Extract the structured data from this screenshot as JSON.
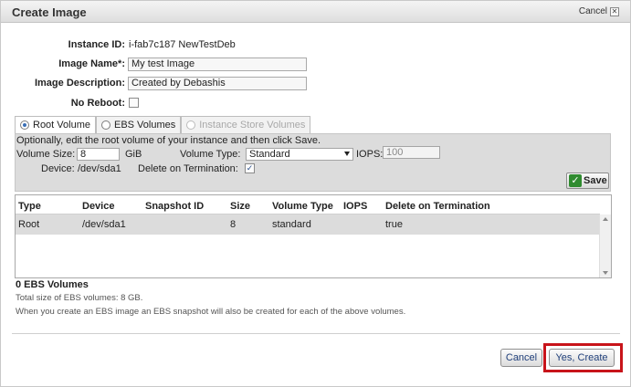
{
  "dialog": {
    "title": "Create Image",
    "cancel_link": "Cancel"
  },
  "form": {
    "instance_id_label": "Instance ID:",
    "instance_id_value": "i-fab7c187 NewTestDeb",
    "image_name_label": "Image Name*:",
    "image_name_value": "My test Image",
    "image_description_label": "Image Description:",
    "image_description_value": "Created by Debashis",
    "no_reboot_label": "No Reboot:"
  },
  "tabs": [
    {
      "label": "Root Volume",
      "selected": true,
      "disabled": false
    },
    {
      "label": "EBS Volumes",
      "selected": false,
      "disabled": false
    },
    {
      "label": "Instance Store Volumes",
      "selected": false,
      "disabled": true
    }
  ],
  "root_volume": {
    "instructions": "Optionally, edit the root volume of your instance and then click Save.",
    "volume_size_label": "Volume Size:",
    "volume_size_value": "8",
    "volume_size_unit": "GiB",
    "volume_type_label": "Volume Type:",
    "volume_type_value": "Standard",
    "iops_label": "IOPS:",
    "iops_value": "100",
    "device_label": "Device:",
    "device_value": "/dev/sda1",
    "delete_on_termination_label": "Delete on Termination:",
    "delete_on_termination_checked": true,
    "save_label": "Save"
  },
  "volumes_table": {
    "columns": [
      "Type",
      "Device",
      "Snapshot ID",
      "Size",
      "Volume Type",
      "IOPS",
      "Delete on Termination"
    ],
    "rows": [
      [
        "Root",
        "/dev/sda1",
        "",
        "8",
        "standard",
        "",
        "true"
      ]
    ]
  },
  "summary": {
    "ebs_count": "0 EBS Volumes",
    "total_size": "Total size of EBS volumes: 8 GB.",
    "snapshot_note": "When you create an EBS image an EBS snapshot will also be created for each of the above volumes."
  },
  "footer": {
    "cancel_label": "Cancel",
    "create_label": "Yes, Create"
  },
  "colors": {
    "highlight": "#c8141a",
    "save_icon": "#2f8b2f",
    "panel_bg": "#dcdcdc"
  }
}
